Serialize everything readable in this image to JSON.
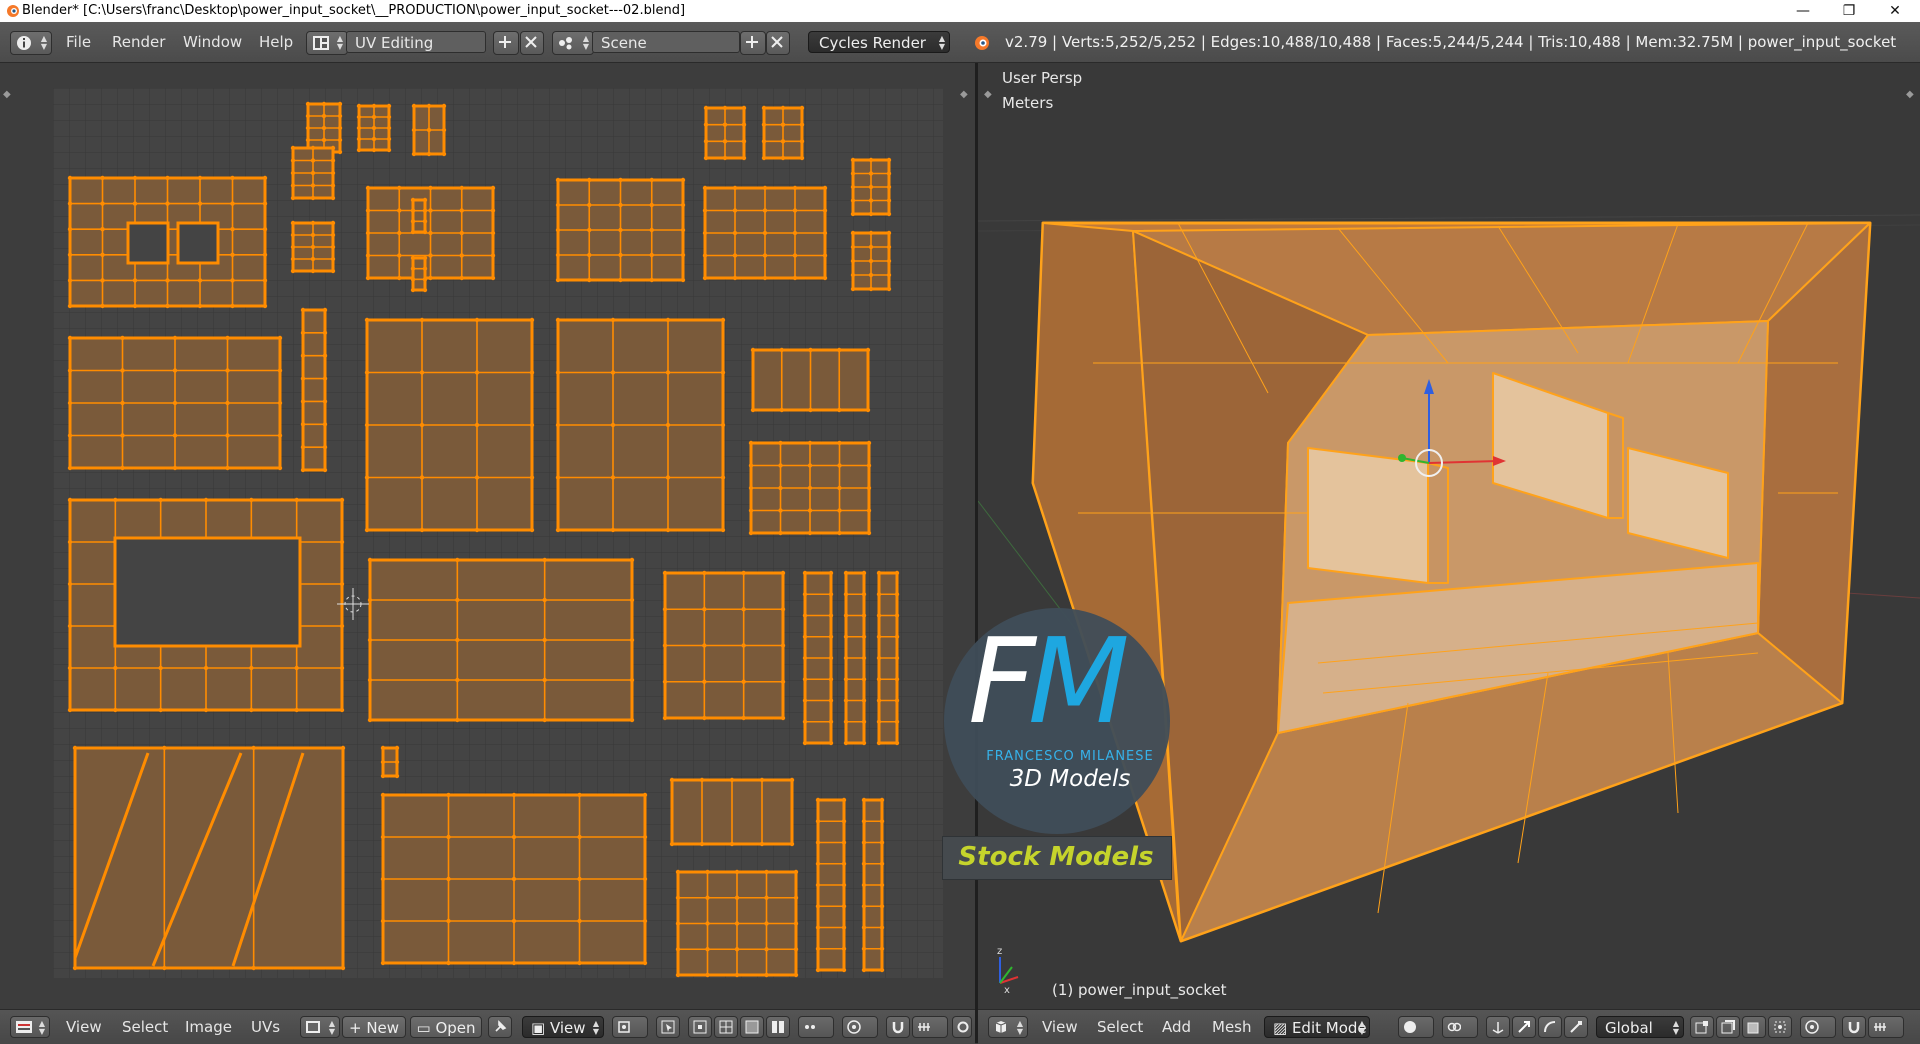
{
  "window": {
    "title": "Blender* [C:\\Users\\franc\\Desktop\\power_input_socket\\__PRODUCTION\\power_input_socket---02.blend]",
    "controls": [
      "—",
      "❐",
      "✕"
    ]
  },
  "header": {
    "menus": [
      "File",
      "Render",
      "Window",
      "Help"
    ],
    "screen_layout": "UV Editing",
    "scene": "Scene",
    "render_engine": "Cycles Render",
    "stats": "v2.79 | Verts:5,252/5,252 | Edges:10,488/10,488 | Faces:5,244/5,244 | Tris:10,488 | Mem:32.75M | power_input_socket"
  },
  "viewport": {
    "view_name": "User Persp",
    "units": "Meters",
    "object_label": "(1) power_input_socket"
  },
  "uv_footer": {
    "menus": [
      "View",
      "Select",
      "Image",
      "UVs"
    ],
    "new_label": "New",
    "open_label": "Open",
    "view_label": "View"
  },
  "viewport_footer": {
    "menus": [
      "View",
      "Select",
      "Add",
      "Mesh"
    ],
    "mode": "Edit Mode",
    "orientation": "Global"
  },
  "watermark": {
    "logo_f": "F",
    "logo_m": "M",
    "author": "FRANCESCO MILANESE",
    "subtitle": "3D Models",
    "band": "Stock Models"
  },
  "colors": {
    "mesh_orange": "#ff8c00",
    "uv_face": "#7a5a3a",
    "background": "#3d3d3d",
    "logo_blue": "#1ea7e0",
    "stock_yellow": "#c5d42c"
  }
}
